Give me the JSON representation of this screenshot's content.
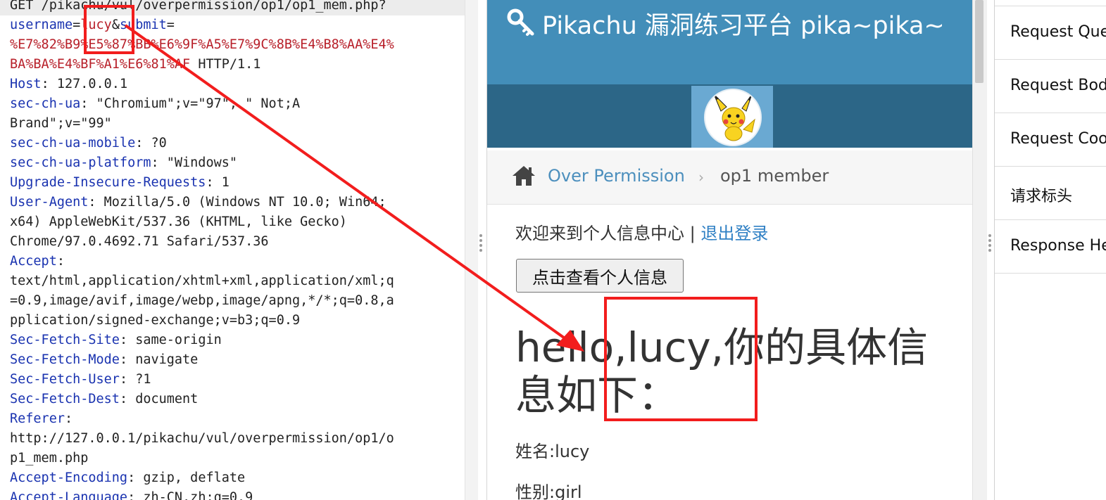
{
  "request": {
    "lines": [
      [
        {
          "c": "hval",
          "t": "GET /pikachu/vul/overpermission/op1/op1_mem.php?"
        }
      ],
      [
        {
          "c": "hname",
          "t": "username"
        },
        {
          "c": "hval",
          "t": "="
        },
        {
          "c": "pval",
          "t": "lucy"
        },
        {
          "c": "hval",
          "t": "&"
        },
        {
          "c": "hname",
          "t": "submit"
        },
        {
          "c": "hval",
          "t": "="
        }
      ],
      [
        {
          "c": "pval",
          "t": "%E7%82%B9%E5%87%BB%E6%9F%A5%E7%9C%8B%E4%B8%AA%E4%"
        }
      ],
      [
        {
          "c": "pval",
          "t": "BA%BA%E4%BF%A1%E6%81%AF"
        },
        {
          "c": "hval",
          "t": " HTTP/1.1"
        }
      ],
      [
        {
          "c": "hname",
          "t": "Host"
        },
        {
          "c": "hval",
          "t": ": 127.0.0.1"
        }
      ],
      [
        {
          "c": "hname",
          "t": "sec-ch-ua"
        },
        {
          "c": "hval",
          "t": ": \"Chromium\";v=\"97\", \" Not;A"
        }
      ],
      [
        {
          "c": "hval",
          "t": "Brand\";v=\"99\""
        }
      ],
      [
        {
          "c": "hname",
          "t": "sec-ch-ua-mobile"
        },
        {
          "c": "hval",
          "t": ": ?0"
        }
      ],
      [
        {
          "c": "hname",
          "t": "sec-ch-ua-platform"
        },
        {
          "c": "hval",
          "t": ": \"Windows\""
        }
      ],
      [
        {
          "c": "hname",
          "t": "Upgrade-Insecure-Requests"
        },
        {
          "c": "hval",
          "t": ": 1"
        }
      ],
      [
        {
          "c": "hname",
          "t": "User-Agent"
        },
        {
          "c": "hval",
          "t": ": Mozilla/5.0 (Windows NT 10.0; Win64;"
        }
      ],
      [
        {
          "c": "hval",
          "t": "x64) AppleWebKit/537.36 (KHTML, like Gecko)"
        }
      ],
      [
        {
          "c": "hval",
          "t": "Chrome/97.0.4692.71 Safari/537.36"
        }
      ],
      [
        {
          "c": "hname",
          "t": "Accept"
        },
        {
          "c": "hval",
          "t": ":"
        }
      ],
      [
        {
          "c": "hval",
          "t": "text/html,application/xhtml+xml,application/xml;q"
        }
      ],
      [
        {
          "c": "hval",
          "t": "=0.9,image/avif,image/webp,image/apng,*/*;q=0.8,a"
        }
      ],
      [
        {
          "c": "hval",
          "t": "pplication/signed-exchange;v=b3;q=0.9"
        }
      ],
      [
        {
          "c": "hname",
          "t": "Sec-Fetch-Site"
        },
        {
          "c": "hval",
          "t": ": same-origin"
        }
      ],
      [
        {
          "c": "hname",
          "t": "Sec-Fetch-Mode"
        },
        {
          "c": "hval",
          "t": ": navigate"
        }
      ],
      [
        {
          "c": "hname",
          "t": "Sec-Fetch-User"
        },
        {
          "c": "hval",
          "t": ": ?1"
        }
      ],
      [
        {
          "c": "hname",
          "t": "Sec-Fetch-Dest"
        },
        {
          "c": "hval",
          "t": ": document"
        }
      ],
      [
        {
          "c": "hname",
          "t": "Referer"
        },
        {
          "c": "hval",
          "t": ":"
        }
      ],
      [
        {
          "c": "hval",
          "t": "http://127.0.0.1/pikachu/vul/overpermission/op1/o"
        }
      ],
      [
        {
          "c": "hval",
          "t": "p1_mem.php"
        }
      ],
      [
        {
          "c": "hname",
          "t": "Accept-Encoding"
        },
        {
          "c": "hval",
          "t": ": gzip, deflate"
        }
      ],
      [
        {
          "c": "hname",
          "t": "Accept-Language"
        },
        {
          "c": "hval",
          "t": ": zh-CN,zh;q=0.9"
        }
      ]
    ]
  },
  "site": {
    "title": "Pikachu 漏洞练习平台 pika~pika~",
    "breadcrumb_section": "Over Permission",
    "breadcrumb_page": "op1 member",
    "welcome_text": "欢迎来到个人信息中心 | ",
    "logout_label": "退出登录",
    "view_info_button": "点击查看个人信息",
    "hello_heading": "hello,lucy,你的具体信息如下：",
    "name_line": "姓名:lucy",
    "gender_line": "性别:girl"
  },
  "inspector": {
    "items": [
      "Request Que",
      "Request Bod",
      "Request Coo",
      "请求标头",
      "Response He"
    ]
  },
  "colors": {
    "header_blue": "#438eb9",
    "subnav_blue": "#2c6687",
    "annotation_red": "#f21d1d"
  },
  "icons": [
    "key-icon",
    "home-icon",
    "pikachu-avatar"
  ]
}
